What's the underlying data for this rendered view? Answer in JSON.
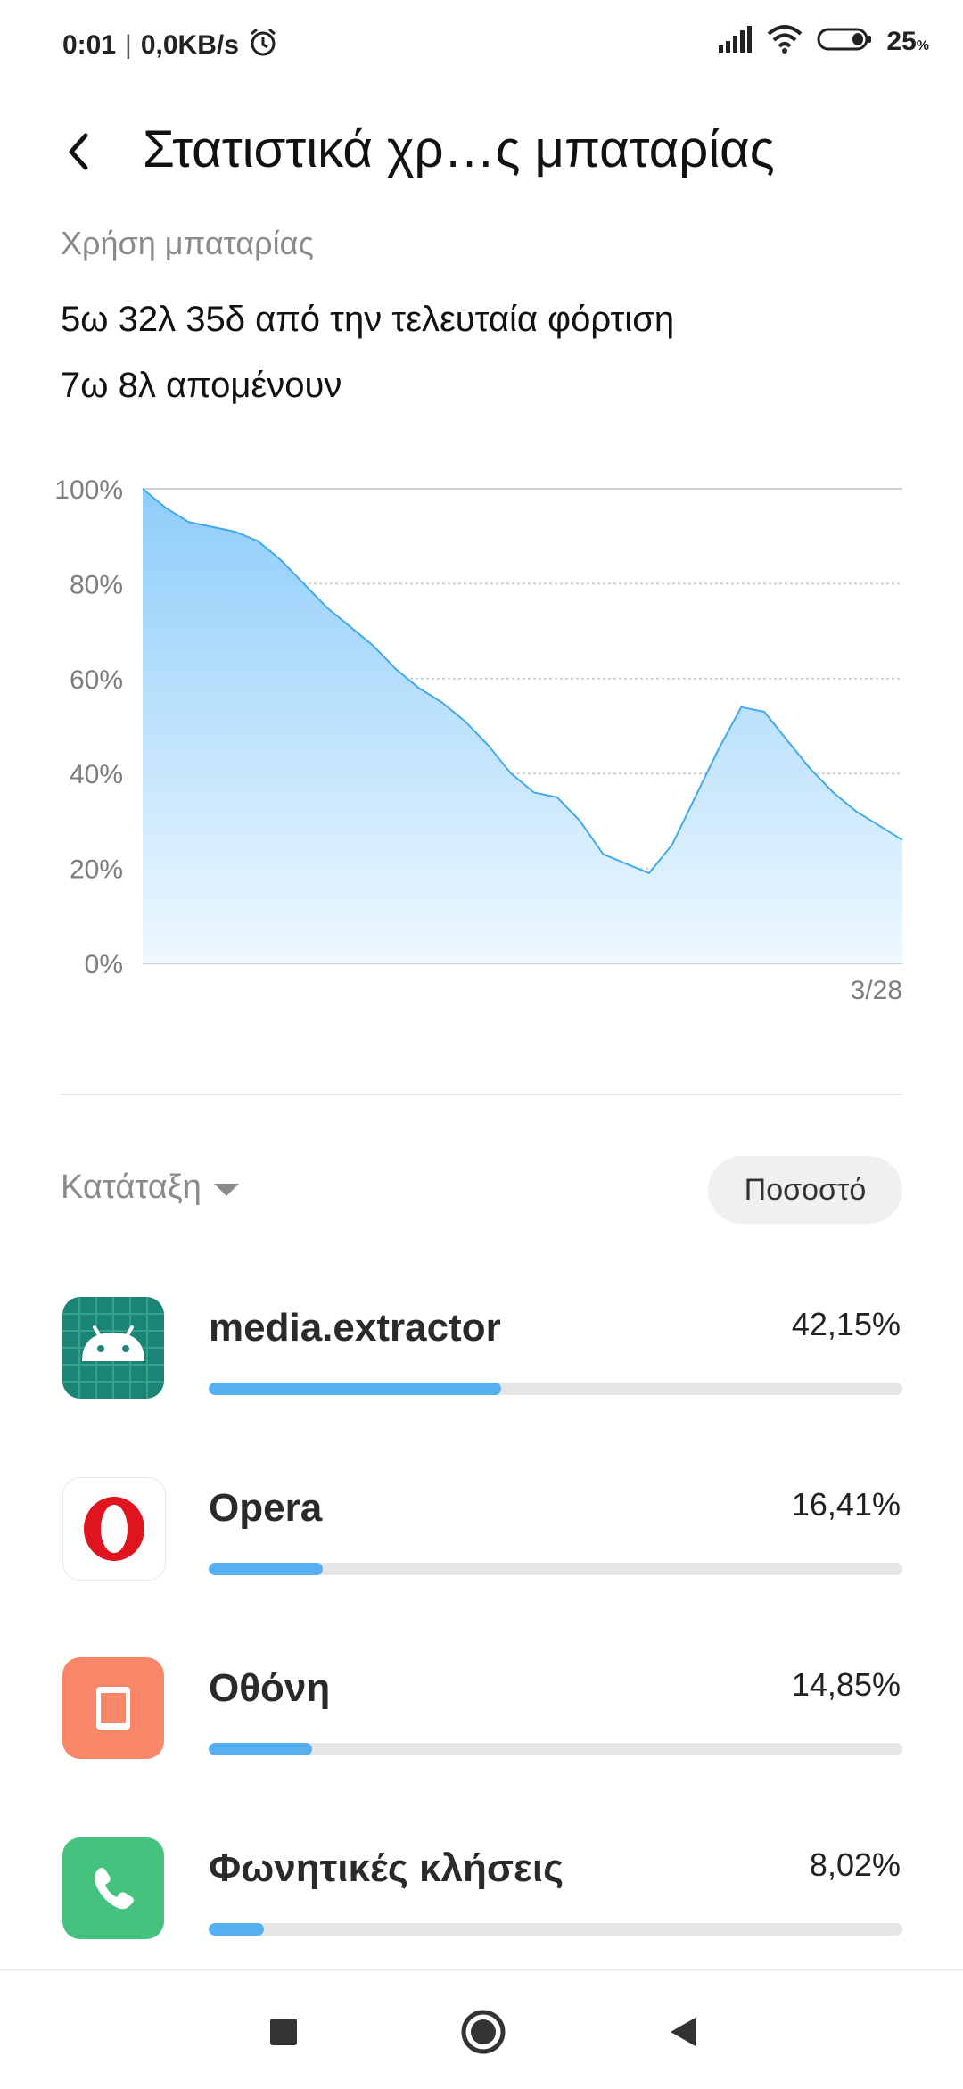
{
  "status_bar": {
    "time": "0:01",
    "separator": "|",
    "speed": "0,0KB/s",
    "battery_percent": "25",
    "battery_unit": "%",
    "icons": [
      "alarm-icon",
      "signal-icon",
      "wifi-icon",
      "battery-icon"
    ]
  },
  "header": {
    "title": "Στατιστικά χρ…ς μπαταρίας"
  },
  "usage": {
    "subtitle": "Χρήση μπαταρίας",
    "since_charge": "5ω 32λ 35δ από την τελευταία φόρτιση",
    "remaining": "7ω 8λ απομένουν"
  },
  "chart_data": {
    "type": "area",
    "y_tick_labels": [
      "100%",
      "80%",
      "60%",
      "40%",
      "20%",
      "0%"
    ],
    "ylim": [
      0,
      100
    ],
    "x_end_label": "3/28",
    "grid": true,
    "series": [
      {
        "values": [
          100,
          96,
          93,
          92,
          91,
          89,
          85,
          80,
          75,
          71,
          67,
          62,
          58,
          55,
          51,
          46,
          40,
          36,
          35,
          30,
          23,
          21,
          19,
          25,
          35,
          45,
          54,
          53,
          47,
          41,
          36,
          32,
          29,
          26
        ]
      }
    ],
    "colors": {
      "line": "#43a9ec",
      "fill_top": "#8ecdfa",
      "fill_bottom": "#eef8ff",
      "grid": "#cfcfcf"
    }
  },
  "sort": {
    "label": "Κατάταξη",
    "button": "Ποσοστό"
  },
  "apps": [
    {
      "name": "media.extractor",
      "percent_text": "42,15%",
      "percent": 42.15,
      "icon": "android-icon",
      "icon_bg": "#1a8574"
    },
    {
      "name": "Opera",
      "percent_text": "16,41%",
      "percent": 16.41,
      "icon": "opera-icon",
      "icon_bg": "#ffffff"
    },
    {
      "name": "Οθόνη",
      "percent_text": "14,85%",
      "percent": 14.85,
      "icon": "screen-icon",
      "icon_bg": "#f8876a"
    },
    {
      "name": "Φωνητικές κλήσεις",
      "percent_text": "8,02%",
      "percent": 8.02,
      "icon": "phone-icon",
      "icon_bg": "#45c27e"
    }
  ],
  "navbar": {
    "icons": [
      "recents-icon",
      "home-icon",
      "back-nav-icon"
    ]
  }
}
